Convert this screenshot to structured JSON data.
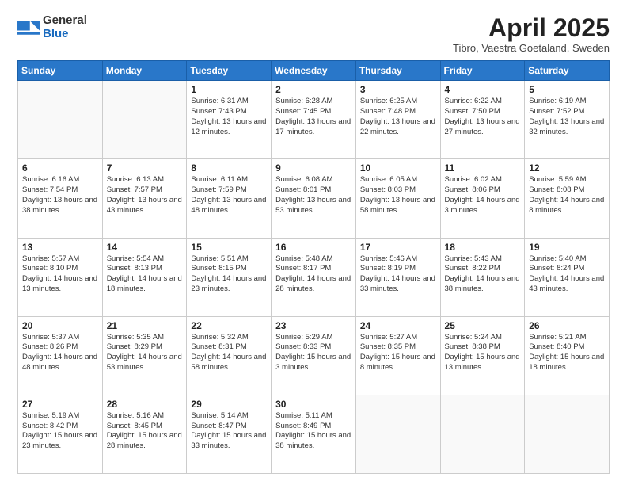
{
  "logo": {
    "general": "General",
    "blue": "Blue"
  },
  "title": "April 2025",
  "subtitle": "Tibro, Vaestra Goetaland, Sweden",
  "days_of_week": [
    "Sunday",
    "Monday",
    "Tuesday",
    "Wednesday",
    "Thursday",
    "Friday",
    "Saturday"
  ],
  "weeks": [
    [
      {
        "day": "",
        "info": ""
      },
      {
        "day": "",
        "info": ""
      },
      {
        "day": "1",
        "info": "Sunrise: 6:31 AM\nSunset: 7:43 PM\nDaylight: 13 hours\nand 12 minutes."
      },
      {
        "day": "2",
        "info": "Sunrise: 6:28 AM\nSunset: 7:45 PM\nDaylight: 13 hours\nand 17 minutes."
      },
      {
        "day": "3",
        "info": "Sunrise: 6:25 AM\nSunset: 7:48 PM\nDaylight: 13 hours\nand 22 minutes."
      },
      {
        "day": "4",
        "info": "Sunrise: 6:22 AM\nSunset: 7:50 PM\nDaylight: 13 hours\nand 27 minutes."
      },
      {
        "day": "5",
        "info": "Sunrise: 6:19 AM\nSunset: 7:52 PM\nDaylight: 13 hours\nand 32 minutes."
      }
    ],
    [
      {
        "day": "6",
        "info": "Sunrise: 6:16 AM\nSunset: 7:54 PM\nDaylight: 13 hours\nand 38 minutes."
      },
      {
        "day": "7",
        "info": "Sunrise: 6:13 AM\nSunset: 7:57 PM\nDaylight: 13 hours\nand 43 minutes."
      },
      {
        "day": "8",
        "info": "Sunrise: 6:11 AM\nSunset: 7:59 PM\nDaylight: 13 hours\nand 48 minutes."
      },
      {
        "day": "9",
        "info": "Sunrise: 6:08 AM\nSunset: 8:01 PM\nDaylight: 13 hours\nand 53 minutes."
      },
      {
        "day": "10",
        "info": "Sunrise: 6:05 AM\nSunset: 8:03 PM\nDaylight: 13 hours\nand 58 minutes."
      },
      {
        "day": "11",
        "info": "Sunrise: 6:02 AM\nSunset: 8:06 PM\nDaylight: 14 hours\nand 3 minutes."
      },
      {
        "day": "12",
        "info": "Sunrise: 5:59 AM\nSunset: 8:08 PM\nDaylight: 14 hours\nand 8 minutes."
      }
    ],
    [
      {
        "day": "13",
        "info": "Sunrise: 5:57 AM\nSunset: 8:10 PM\nDaylight: 14 hours\nand 13 minutes."
      },
      {
        "day": "14",
        "info": "Sunrise: 5:54 AM\nSunset: 8:13 PM\nDaylight: 14 hours\nand 18 minutes."
      },
      {
        "day": "15",
        "info": "Sunrise: 5:51 AM\nSunset: 8:15 PM\nDaylight: 14 hours\nand 23 minutes."
      },
      {
        "day": "16",
        "info": "Sunrise: 5:48 AM\nSunset: 8:17 PM\nDaylight: 14 hours\nand 28 minutes."
      },
      {
        "day": "17",
        "info": "Sunrise: 5:46 AM\nSunset: 8:19 PM\nDaylight: 14 hours\nand 33 minutes."
      },
      {
        "day": "18",
        "info": "Sunrise: 5:43 AM\nSunset: 8:22 PM\nDaylight: 14 hours\nand 38 minutes."
      },
      {
        "day": "19",
        "info": "Sunrise: 5:40 AM\nSunset: 8:24 PM\nDaylight: 14 hours\nand 43 minutes."
      }
    ],
    [
      {
        "day": "20",
        "info": "Sunrise: 5:37 AM\nSunset: 8:26 PM\nDaylight: 14 hours\nand 48 minutes."
      },
      {
        "day": "21",
        "info": "Sunrise: 5:35 AM\nSunset: 8:29 PM\nDaylight: 14 hours\nand 53 minutes."
      },
      {
        "day": "22",
        "info": "Sunrise: 5:32 AM\nSunset: 8:31 PM\nDaylight: 14 hours\nand 58 minutes."
      },
      {
        "day": "23",
        "info": "Sunrise: 5:29 AM\nSunset: 8:33 PM\nDaylight: 15 hours\nand 3 minutes."
      },
      {
        "day": "24",
        "info": "Sunrise: 5:27 AM\nSunset: 8:35 PM\nDaylight: 15 hours\nand 8 minutes."
      },
      {
        "day": "25",
        "info": "Sunrise: 5:24 AM\nSunset: 8:38 PM\nDaylight: 15 hours\nand 13 minutes."
      },
      {
        "day": "26",
        "info": "Sunrise: 5:21 AM\nSunset: 8:40 PM\nDaylight: 15 hours\nand 18 minutes."
      }
    ],
    [
      {
        "day": "27",
        "info": "Sunrise: 5:19 AM\nSunset: 8:42 PM\nDaylight: 15 hours\nand 23 minutes."
      },
      {
        "day": "28",
        "info": "Sunrise: 5:16 AM\nSunset: 8:45 PM\nDaylight: 15 hours\nand 28 minutes."
      },
      {
        "day": "29",
        "info": "Sunrise: 5:14 AM\nSunset: 8:47 PM\nDaylight: 15 hours\nand 33 minutes."
      },
      {
        "day": "30",
        "info": "Sunrise: 5:11 AM\nSunset: 8:49 PM\nDaylight: 15 hours\nand 38 minutes."
      },
      {
        "day": "",
        "info": ""
      },
      {
        "day": "",
        "info": ""
      },
      {
        "day": "",
        "info": ""
      }
    ]
  ]
}
